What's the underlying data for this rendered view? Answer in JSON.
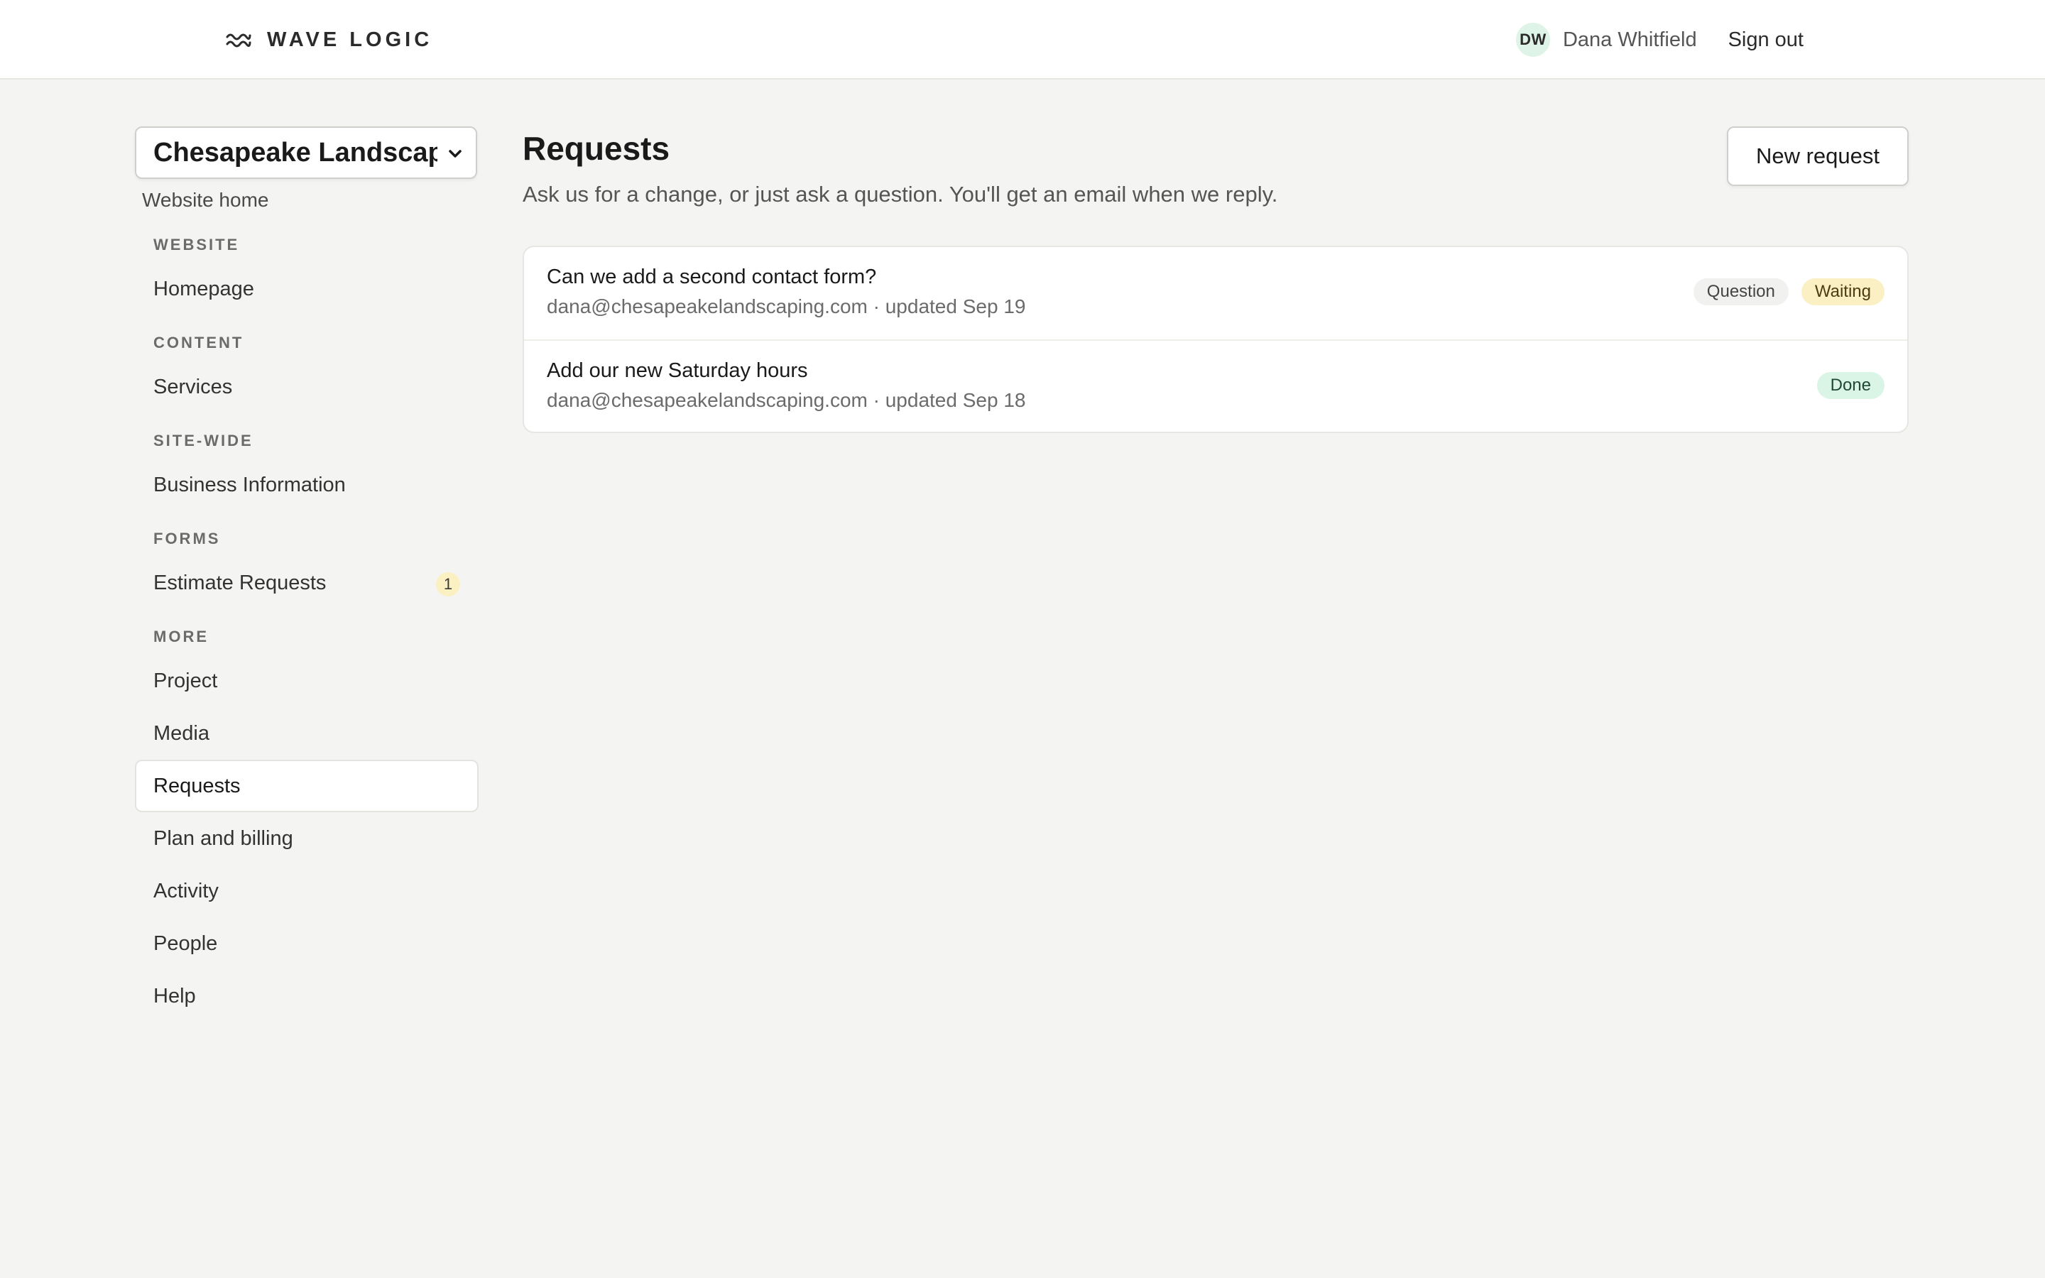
{
  "brand": {
    "name": "WAVE LOGIC",
    "icon": "waves-icon"
  },
  "user": {
    "initials": "DW",
    "name": "Dana Whitfield",
    "sign_out_label": "Sign out"
  },
  "sidebar": {
    "site_select": {
      "value": "Chesapeake Landscapi…",
      "icon": "chevron-down-icon"
    },
    "website_home_label": "Website home",
    "sections": [
      {
        "title": "WEBSITE",
        "items": [
          {
            "label": "Homepage"
          }
        ]
      },
      {
        "title": "CONTENT",
        "items": [
          {
            "label": "Services"
          }
        ]
      },
      {
        "title": "SITE-WIDE",
        "items": [
          {
            "label": "Business Information"
          }
        ]
      },
      {
        "title": "FORMS",
        "items": [
          {
            "label": "Estimate Requests",
            "badge": "1"
          }
        ]
      },
      {
        "title": "MORE",
        "items": [
          {
            "label": "Project"
          },
          {
            "label": "Media"
          },
          {
            "label": "Requests",
            "active": true
          },
          {
            "label": "Plan and billing"
          },
          {
            "label": "Activity"
          },
          {
            "label": "People"
          },
          {
            "label": "Help"
          }
        ]
      }
    ]
  },
  "main": {
    "title": "Requests",
    "subtitle": "Ask us for a change, or just ask a question. You'll get an email when we reply.",
    "new_request_label": "New request",
    "requests": [
      {
        "title": "Can we add a second contact form?",
        "meta": "dana@chesapeakelandscaping.com · updated Sep 19",
        "tags": [
          {
            "label": "Question",
            "kind": "question"
          },
          {
            "label": "Waiting",
            "kind": "waiting"
          }
        ]
      },
      {
        "title": "Add our new Saturday hours",
        "meta": "dana@chesapeakelandscaping.com · updated Sep 18",
        "tags": [
          {
            "label": "Done",
            "kind": "done"
          }
        ]
      }
    ]
  },
  "colors": {
    "page_background": "#f4f4f2",
    "surface": "#ffffff",
    "badge_yellow": "#fbefc4",
    "badge_green": "#daf4e6",
    "badge_gray": "#f1f1ef"
  }
}
